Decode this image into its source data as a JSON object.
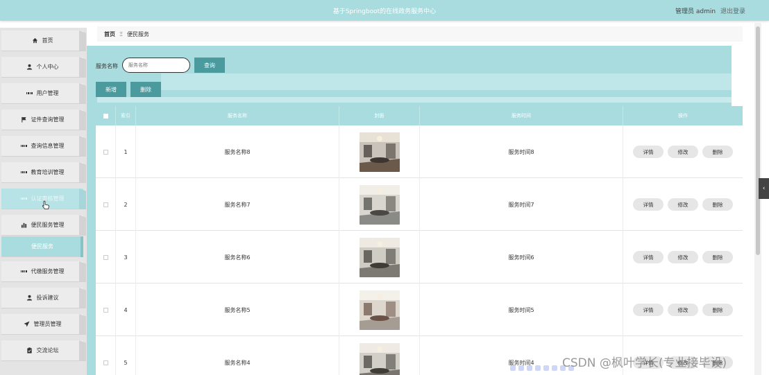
{
  "app": {
    "title": "基于Springboot的在线政务服务中心"
  },
  "user": {
    "label": "管理员 admin",
    "logout": "退出登录"
  },
  "sidebar": {
    "items": [
      {
        "label": "首页",
        "icon": "home-icon"
      },
      {
        "label": "个人中心",
        "icon": "user-icon"
      },
      {
        "label": "用户管理",
        "icon": "grid-icon"
      },
      {
        "label": "证件查询管理",
        "icon": "flag-icon"
      },
      {
        "label": "查询信息管理",
        "icon": "grid-icon"
      },
      {
        "label": "教育培训管理",
        "icon": "grid-icon"
      },
      {
        "label": "认证审核管理",
        "icon": "grid-icon"
      },
      {
        "label": "便民服务管理",
        "icon": "bar-chart-icon"
      },
      {
        "label": "便民服务",
        "icon": ""
      },
      {
        "label": "代缴服务管理",
        "icon": "grid-icon"
      },
      {
        "label": "投诉建议",
        "icon": "user-icon"
      },
      {
        "label": "管理员管理",
        "icon": "send-icon"
      },
      {
        "label": "交流论坛",
        "icon": "clipboard-icon"
      }
    ]
  },
  "breadcrumb": {
    "home": "首页",
    "separator": "Ξ",
    "current": "便民服务"
  },
  "search": {
    "label": "服务名称",
    "placeholder": "服务名称",
    "button": "查询"
  },
  "toolbar": {
    "add": "新增",
    "delete": "删除"
  },
  "table": {
    "headers": {
      "index": "索引",
      "name": "服务名称",
      "cover": "封面",
      "time": "服务时间",
      "actions": "操作"
    },
    "actions": {
      "detail": "详情",
      "edit": "修改",
      "delete": "删除"
    },
    "rows": [
      {
        "index": "1",
        "name": "服务名称8",
        "time": "服务时间8"
      },
      {
        "index": "2",
        "name": "服务名称7",
        "time": "服务时间7"
      },
      {
        "index": "3",
        "name": "服务名称6",
        "time": "服务时间6"
      },
      {
        "index": "4",
        "name": "服务名称5",
        "time": "服务时间5"
      },
      {
        "index": "5",
        "name": "服务名称4",
        "time": "服务时间4"
      }
    ]
  },
  "watermark": "CSDN @枫叶学长(专业接毕设)",
  "colors": {
    "accent": "#a8dcdf",
    "button": "#4a9a9e",
    "sidebar": "#e4e4e4"
  }
}
